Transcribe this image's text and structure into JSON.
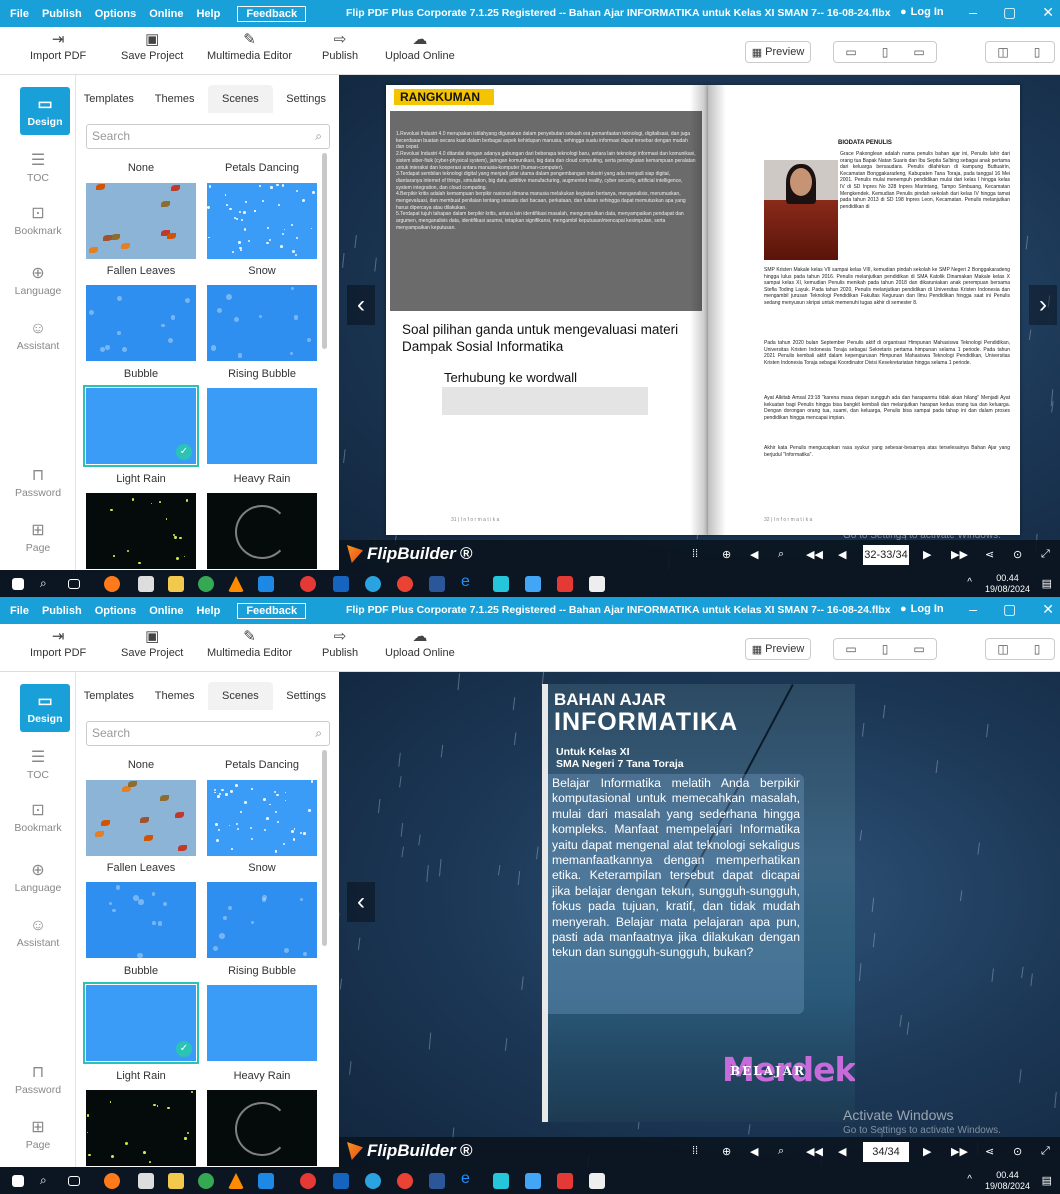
{
  "menu": [
    "File",
    "Publish",
    "Options",
    "Online",
    "Help"
  ],
  "feedback": "Feedback",
  "app_title": "Flip PDF Plus Corporate 7.1.25 Registered -- Bahan Ajar INFORMATIKA untuk Kelas XI SMAN 7-- 16-08-24.flbx",
  "login": "Log In",
  "toolbar": {
    "import": "Import PDF",
    "save": "Save Project",
    "multimedia": "Multimedia Editor",
    "publish": "Publish",
    "upload": "Upload Online",
    "preview": "Preview"
  },
  "nav": {
    "design": "Design",
    "toc": "TOC",
    "bookmark": "Bookmark",
    "language": "Language",
    "assistant": "Assistant",
    "password": "Password",
    "page": "Page"
  },
  "tabs": [
    "Templates",
    "Themes",
    "Scenes",
    "Settings"
  ],
  "search_placeholder": "Search",
  "scenes": {
    "none": "None",
    "petals": "Petals Dancing",
    "fallen": "Fallen Leaves",
    "snow": "Snow",
    "bubble": "Bubble",
    "rising": "Rising Bubble",
    "light_rain": "Light Rain",
    "heavy_rain": "Heavy Rain"
  },
  "brand": "FlipBuilder",
  "activate": "Activate Windows",
  "activate_sub": "Go to Settings to activate Windows.",
  "tray": {
    "time": "00.44",
    "date": "19/08/2024"
  },
  "shot_a": {
    "page_indicator": "32-33/34",
    "left_page": {
      "rk_title": "RANGKUMAN",
      "rk_items": [
        "1.Revolusi Industri 4.0 merupakan istilahyang digunakan dalam penyebutan sebuah era pemanfaatan teknologi, digitalisasi, dan juga kecerdasan buatan secara kuat dalam berbagai aspek kehidupan manusia, sehingga suatu informasi dapat tersebar dengan mudah dan cepat.",
        "2.Revolusi Industri 4.0 ditandai dengan adanya gabungan dari beberapa teknologi baru, antara lain teknologi informasi dan komunikasi, sistem siber-fisik (cyber-physical system), jaringan komunikasi, big data dan cloud computing, serta peningkatan kemampuan peralatan untuk interaksi dan kooperasi antara manusia-komputer (human-computer).",
        "3.Terdapat sembilan teknologi digital yang menjadi pilar utama dalam pengembangan industri yang ada menjadi siap digital, diantaranya internet of things, simulation, big data, additive manufacturing, augmented reality, cyber security, artificial intelligence, system integration, dan cloud computing.",
        "4.Berpikir kritis adalah kemampuan berpikir rasional dimana manusia melakukan kegiatan bertanya, menganalisis, merumuskan, mengevaluasi, dan membuat penilaian tentang sesuatu dari bacaan, perkataan, dan tulisan sehingga dapat memutuskan apa yang harus dipercaya atau dilakukan.",
        "5.Terdapat tujuh tahapan dalam berpikir kritis, antara lain identifikasi masalah, mengumpulkan data, menyampaikan pendapat dan argumen, menganalisis data, identifikasi asumsi, tetapkan signifikansi, mengambil keputusan/mencapai kesimpulan, serta menyampaikan keputusan."
      ],
      "soal": "Soal pilihan ganda untuk mengevaluasi materi Dampak Sosial Informatika",
      "terhubung": "Terhubung ke wordwall",
      "footer": "31 | I n f o r m a t i k a"
    },
    "right_page": {
      "bio_title": "BIODATA PENULIS",
      "bio_top": "Grace Pakonglean adalah nama penulis bahan ajar ini, Penulis lahir dari orang tua Bapak Natan Suaris dan Ibu Septia Sa'bing sebagai anak pertama dari keluarga bersaudara. Penulis dilahirkan di kampung Buttuairin, Kecamatan Bonggakaradeng, Kabupaten Tana Toraja, pada tanggal 16 Mei 2001. Penulis mulai menempuh pendidikan mulai dari kelas I hingga kelas IV di SD Inpres No 328 Inpres Marintang, Tampo Simbuang, Kecamatan Mengkendek. Kemudian Penulis pindah sekolah dari kelas IV hingga tamat pada tahun 2013 di SD 198 Inpres Leon, Kecamatan. Penulis melanjutkan pendidikan di",
      "bio_1": "SMP Kristen Makale kelas VII sampai kelas VIII, kemudian pindah sekolah ke SMP Negeri 2 Bonggakaradeng hingga lulus pada tahun 2016. Penulis melanjutkan pendidikan di SMA Katolik Dinamakan Makale kelas X sampai kelas XI, kemudian Penulis menikah pada tahun 2018 dan dikaruniakan anak perempuan bersama Stefla Toding Layuk. Pada tahun 2020, Penulis melanjutkan pendidikan di Universitas Kristen Indonesia dan mengambil jurusan Teknologi Pendidikan Fakultas Keguruan dan Ilmu Pendidikan hingga saat ini Penulis sedang menyusun skripsi untuk memenuhi tugas akhir di semester 8.",
      "bio_2": "Pada tahun 2020 bulan September Penulis aktif di organisasi Himpunan Mahasiswa Teknologi Pendidikan, Universitas Kristen Indonesia Toraja sebagai Sekretaris pertama himpunan selama 1 periode. Pada tahun 2021 Penulis kembali aktif dalam kepengurusan Himpunan Mahasiswa Teknologi Pendidikan, Universitas Kristen Indonesia Toraja sebagai Koordinator Divisi Kesekretariatan hingga selama 1 periode.",
      "bio_3": "Ayat Alkitab Amsal 23:18 \"karena masa depan sungguh ada dan harapanmu tidak akan hilang\" Menjadi Ayat kekuatan bagi Penulis hingga bisa bangkit kembali dan melanjutkan harapan kedua orang tua dan keluarga. Dengan dorongan orang tua, suami, dan keluarga, Penulis bisa sampai pada tahap ini dan dalam proses pendidikan hingga mencapai impian.",
      "bio_4": "Akhir kata Penulis mengucapkan rasa syukur yang sebesar-besarnya atas terselesainya Bahan Ajar yang berjudul \"Informatika\".",
      "footer": "32 | I n f o r m a t i k a"
    }
  },
  "shot_b": {
    "page_indicator": "34/34",
    "cover": {
      "t1": "BAHAN AJAR",
      "t2": "INFORMATIKA",
      "t3a": "Untuk Kelas XI",
      "t3b": "SMA Negeri 7 Tana Toraja",
      "body": "Belajar Informatika melatih Anda berpikir komputasional untuk memecahkan masalah, mulai dari masalah yang sederhana hingga kompleks. Manfaat mempelajari Informatika yaitu dapat mengenal alat teknologi sekaligus memanfaatkannya dengan memperhatikan etika. Keterampilan tersebut dapat dicapai jika belajar dengan tekun, sungguh-sungguh, fokus pada tujuan, kratif, dan tidak mudah menyerah. Belajar mata pelajaran apa pun, pasti ada manfaatnya jika dilakukan dengan tekun dan sungguh-sungguh, bukan?",
      "belajar": "BELAJAR",
      "merdeka": "Merdeka"
    }
  },
  "colors": {
    "accent": "#1aa0d8",
    "selection": "#2bc4b4",
    "scene_blue": "#3a9cf7"
  }
}
